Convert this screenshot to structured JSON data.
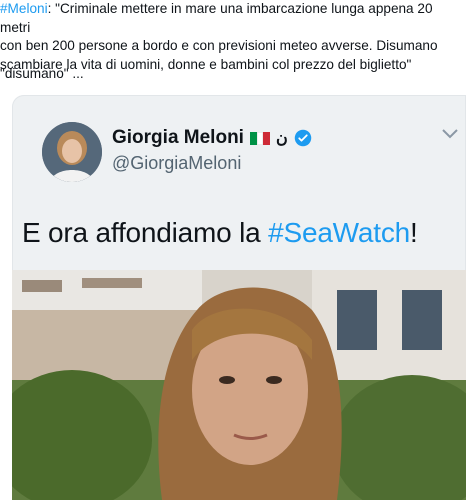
{
  "post": {
    "hashtag": "#Meloni",
    "body_line1": ": \"Criminale mettere in mare una imbarcazione lunga appena 20 metri",
    "body_line2": "con ben 200 persone a bordo e con previsioni meteo avverse. Disumano",
    "body_line3": "scambiare la vita di uomini, donne e bambini col prezzo del biglietto\"",
    "quote_line": "\"disumano\" ..."
  },
  "embedded_tweet": {
    "display_name": "Giorgia Meloni",
    "name_suffix": "ن",
    "handle": "@GiorgiaMeloni",
    "text_main": "E ora affondiamo la ",
    "text_hashtag": "#SeaWatch",
    "text_end": "!",
    "flag_colors": [
      "#009246",
      "#ffffff",
      "#ce2b37"
    ],
    "verified_color": "#1d9bf0",
    "more_icon": "chevron-down-icon"
  }
}
